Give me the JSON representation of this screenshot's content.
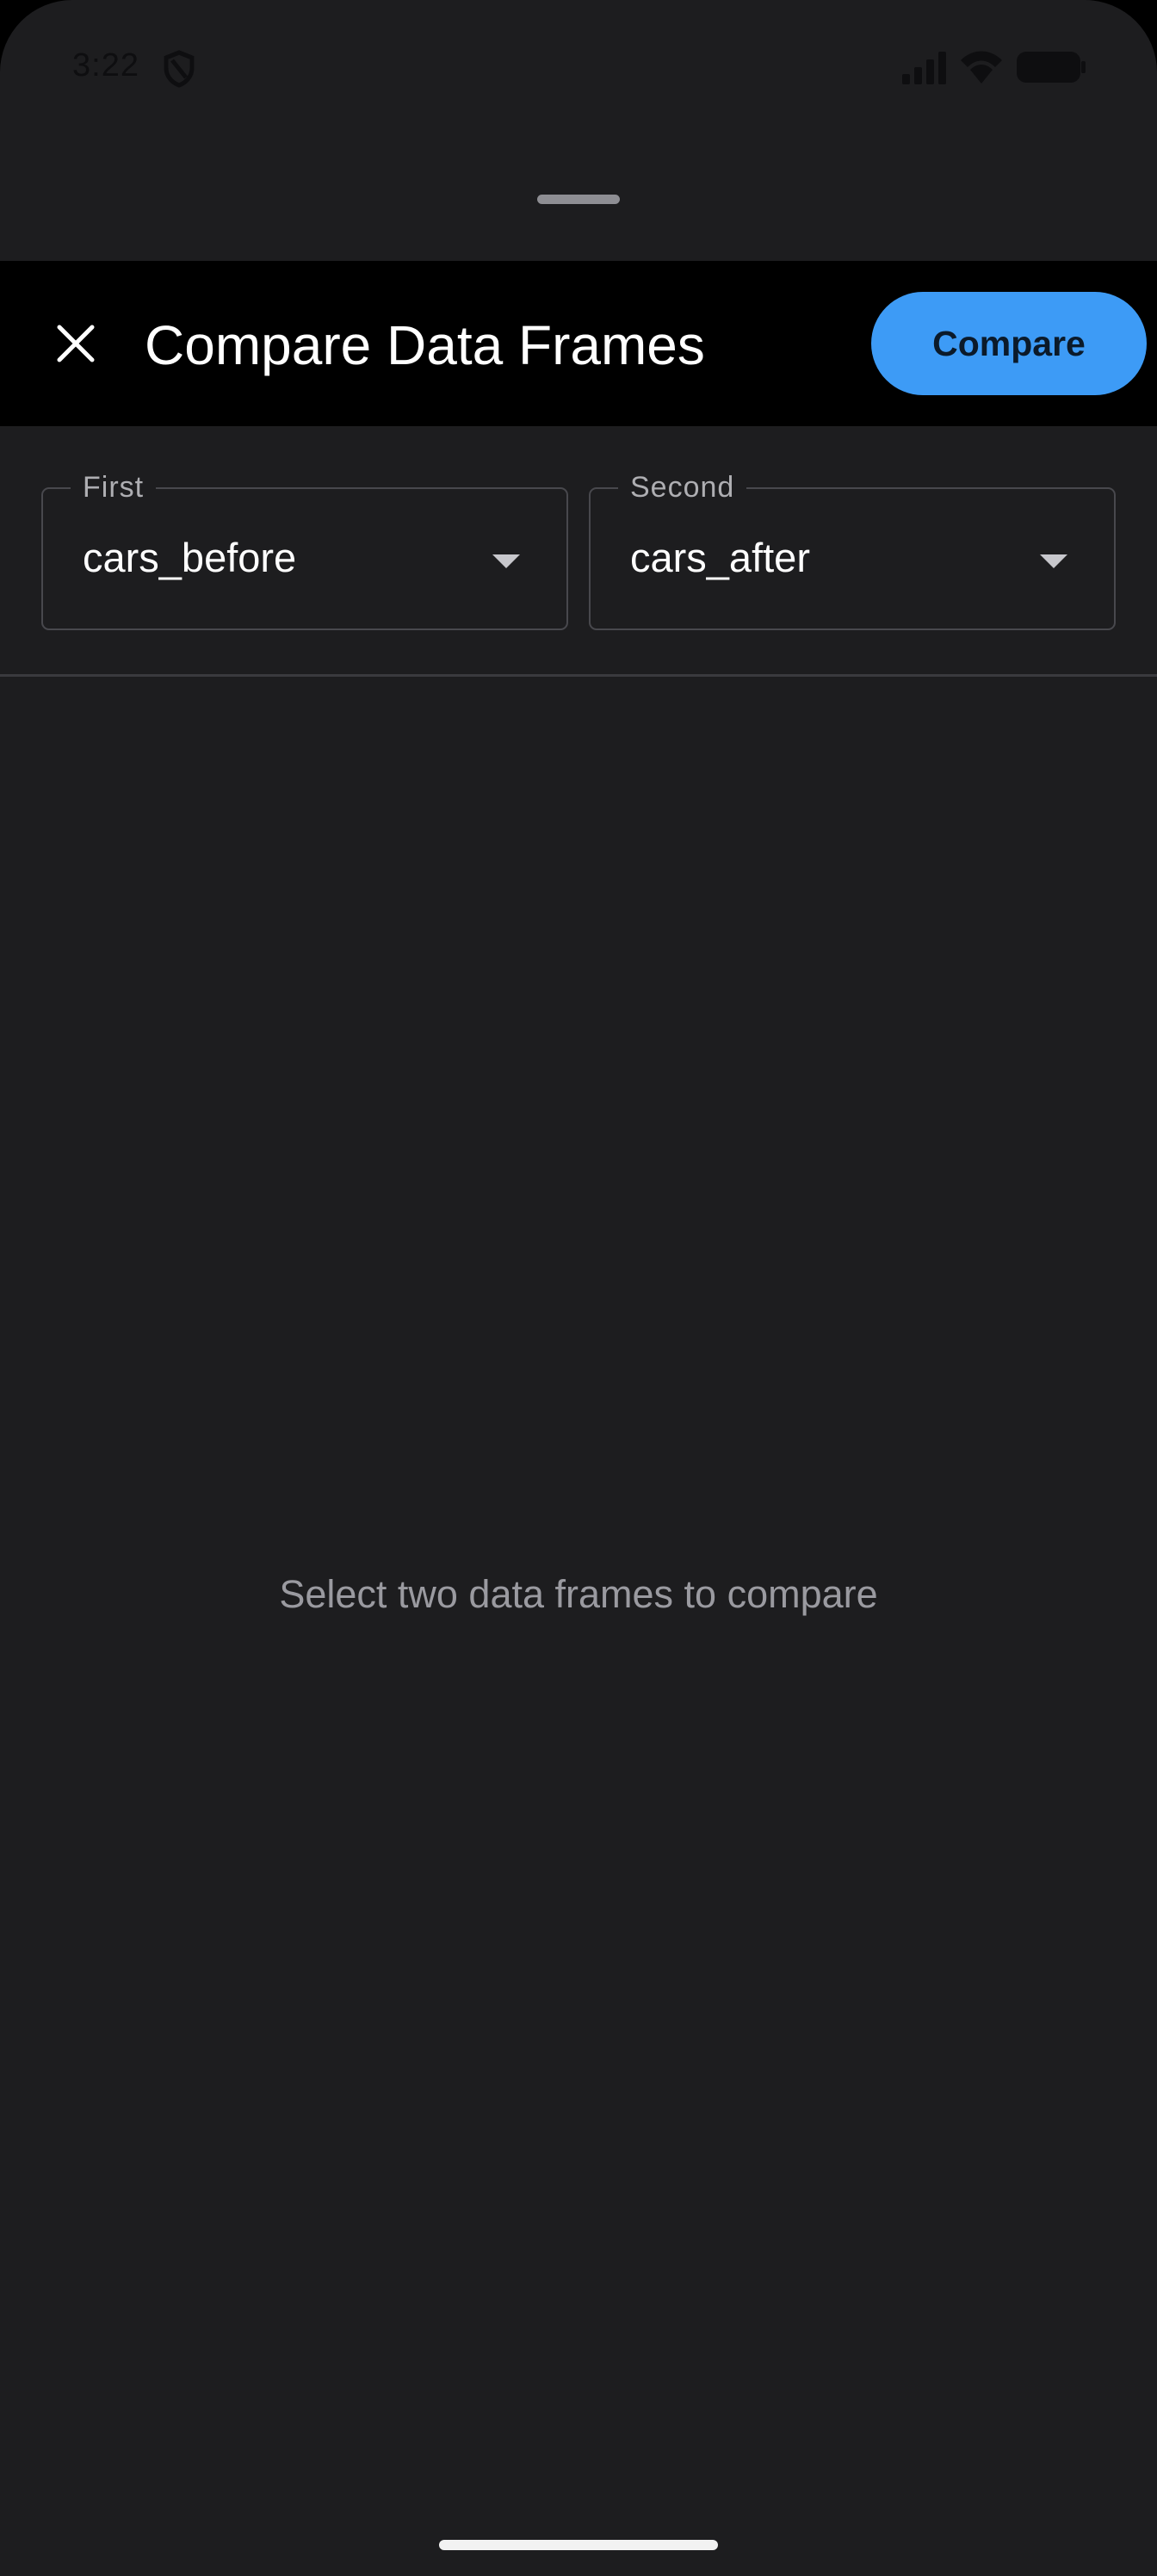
{
  "status_bar": {
    "time": "3:22",
    "icons": [
      "shield-icon",
      "signal-icon",
      "wifi-icon",
      "battery-icon"
    ]
  },
  "sheet": {
    "has_drag_handle": true
  },
  "app_bar": {
    "close_icon": "close-icon",
    "title": "Compare Data Frames",
    "action_label": "Compare",
    "action_color": "#3d9bf6"
  },
  "selectors": {
    "first": {
      "label": "First",
      "value": "cars_before"
    },
    "second": {
      "label": "Second",
      "value": "cars_after"
    }
  },
  "content": {
    "empty_message": "Select two data frames to compare"
  },
  "colors": {
    "background": "#1d1d1f",
    "app_bar": "#000000",
    "accent": "#3d9bf6"
  }
}
